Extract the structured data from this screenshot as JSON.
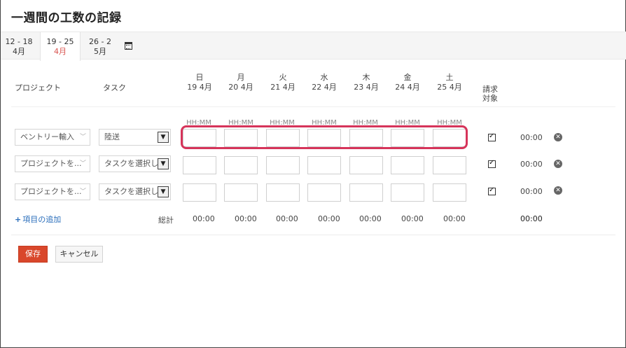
{
  "page": {
    "title": "一週間の工数の記録"
  },
  "weeks": [
    {
      "range": "12 - 18",
      "month": "4月",
      "active": false
    },
    {
      "range": "19 - 25",
      "month": "4月",
      "active": true
    },
    {
      "range": "26 - 2",
      "month": "5月",
      "active": false
    }
  ],
  "headers": {
    "project": "プロジェクト",
    "task": "タスク",
    "billable": "請求対象",
    "days": [
      {
        "day": "日",
        "date": "19 4月"
      },
      {
        "day": "月",
        "date": "20 4月"
      },
      {
        "day": "火",
        "date": "21 4月"
      },
      {
        "day": "水",
        "date": "22 4月"
      },
      {
        "day": "木",
        "date": "23 4月"
      },
      {
        "day": "金",
        "date": "24 4月"
      },
      {
        "day": "土",
        "date": "25 4月"
      }
    ],
    "time_placeholder": "HH:MM"
  },
  "rows": [
    {
      "project": "ベントリー輸入",
      "task": "陸送",
      "billable": true,
      "total": "00:00"
    },
    {
      "project": "プロジェクトを...",
      "task": "タスクを選択して",
      "billable": true,
      "total": "00:00"
    },
    {
      "project": "プロジェクトを...",
      "task": "タスクを選択して",
      "billable": true,
      "total": "00:00"
    }
  ],
  "footer": {
    "add_item": "項目の追加",
    "total_label": "総計",
    "day_totals": [
      "00:00",
      "00:00",
      "00:00",
      "00:00",
      "00:00",
      "00:00",
      "00:00"
    ],
    "grand_total": "00:00"
  },
  "buttons": {
    "save": "保存",
    "cancel": "キャンセル"
  },
  "icons": {
    "calendar": "calendar-icon",
    "delete": "close-circle-icon",
    "chevron": "chevron-down-icon"
  },
  "colors": {
    "highlight": "#d6345a",
    "active_month": "#d9534f",
    "save_button": "#d9472b",
    "link": "#2a6ebb"
  }
}
